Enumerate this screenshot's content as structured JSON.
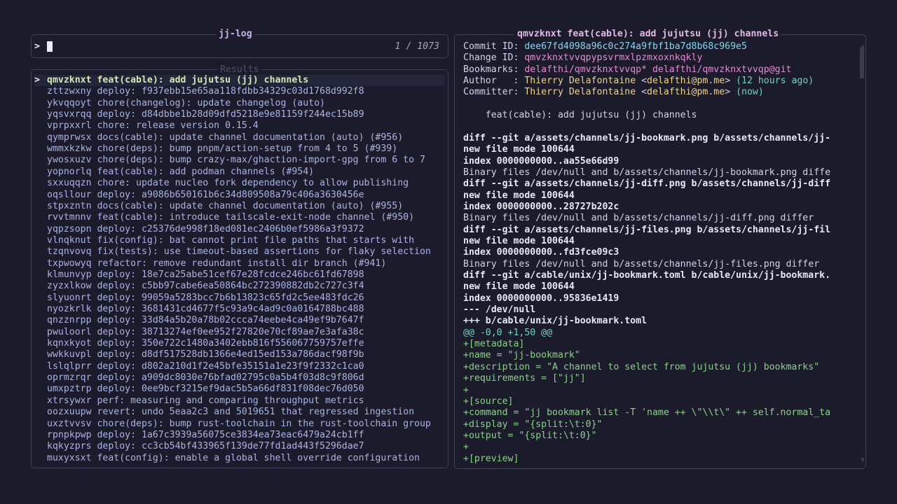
{
  "search": {
    "title": "jj-log",
    "prompt": ">",
    "count": "1 / 1073"
  },
  "results": {
    "title": "Results",
    "selected_marker": ">",
    "items": [
      "qmvzknxt feat(cable): add jujutsu (jj) channels",
      "zttzwxny deploy: f937ebb15e65aa118fdbb34329c03d1768d992f8",
      "ykvqqoyt chore(changelog): update changelog (auto)",
      "yqsvxrqq deploy: d84dbbe1b28d09dfd5218e9e81159f244ec15b89",
      "vprpxxrl chore: release version 0.15.4",
      "qymprwsx docs(cable): update channel documentation (auto) (#956)",
      "wmmxkzkw chore(deps): bump pnpm/action-setup from 4 to 5 (#939)",
      "ywosxuzv chore(deps): bump crazy-max/ghaction-import-gpg from 6 to 7",
      "yopnorlq feat(cable): add podman channels (#954)",
      "sxxuqqzn chore: update nucleo fork dependency to allow publishing",
      "oqsllour deploy: a9086b650161b6c34d809508a79c406a3630456e",
      "stpxzntn docs(cable): update channel documentation (auto) (#955)",
      "rvvtmnnv feat(cable): introduce tailscale-exit-node channel (#950)",
      "yqpzsopn deploy: c25376de998f18ed081ec2406b0ef5986a3f9372",
      "vlnqknut fix(config): bat cannot print file paths that starts with",
      "tzqnvovq fix(tests): use timeout-based assertions for flaky selection",
      "txpwowyq refactor: remove redundant install dir branch (#941)",
      "klmunvyp deploy: 18e7ca25abe51cef67e28fcdce246bc61fd67898",
      "zyzxlkow deploy: c5bb97cabe6ea50864bc272390882db2c727c3f4",
      "slyuonrt deploy: 99059a5283bcc7b6b13823c65fd2c5ee483fdc26",
      "nyozkrlk deploy: 3681431cd4677f5c93a9c4ad9c0a0164788bc488",
      "qnzznrpp deploy: 33d84a5b20a78b02ccca74eebe4ca49ef9b7647f",
      "pwuloorl deploy: 38713274ef0ee952f27820e70cf89ae7e3afa38c",
      "kqnxkyot deploy: 350e722c1480a3402ebb816f556067759757effe",
      "wwkkuvpl deploy: d8df517528db1366e4ed15ed153a786dacf98f9b",
      "lslqlprr deploy: d802a210d1f2e45bfe35151a1e23f9f2332c1ca0",
      "oprmzrqr deploy: a909dc8030e76bfad02795c0a5b4f03d8c9f806d",
      "umxpztrp deploy: 0ee9bcf3215ef9dac5b5a66df831f08dec76d050",
      "xtrsywxr perf: measuring and comparing throughput metrics",
      "oozxuupw revert: undo 5eaa2c3 and 5019651 that regressed ingestion",
      "uxztvvsv chore(deps): bump rust-toolchain in the rust-toolchain group",
      "rpnpkpwp deploy: 1a67c3939a56075ce3834ea73eac6479a24cb1ff",
      "kqkyzprs deploy: cc3cb54bf433965f139de77fd1ad443f5296dae7",
      "muxyxsxt feat(config): enable a global shell override configuration"
    ]
  },
  "preview": {
    "title": "qmvzknxt feat(cable): add jujutsu (jj) channels",
    "lines": [
      [
        {
          "t": "Commit ID: ",
          "c": "k"
        },
        {
          "t": "dee67fd4098a96c0c274a9fbf1ba7d8b68c969e5",
          "c": "cyan"
        }
      ],
      [
        {
          "t": "Change ID: ",
          "c": "k"
        },
        {
          "t": "qmvzknxtvvqpypsvrmxlpzmxoxnkqkly",
          "c": "magenta"
        }
      ],
      [
        {
          "t": "Bookmarks: ",
          "c": "k"
        },
        {
          "t": "delafthi/qmvzknxtvvqp* delafthi/qmvzknxtvvqp@git",
          "c": "magenta"
        }
      ],
      [
        {
          "t": "Author   : ",
          "c": "k"
        },
        {
          "t": "Thierry Delafontaine",
          "c": "yellow"
        },
        {
          "t": " <",
          "c": "k"
        },
        {
          "t": "delafthi@pm.me",
          "c": "yellow"
        },
        {
          "t": "> ",
          "c": "k"
        },
        {
          "t": "(12 hours ago)",
          "c": "teal"
        }
      ],
      [
        {
          "t": "Committer: ",
          "c": "k"
        },
        {
          "t": "Thierry Delafontaine",
          "c": "yellow"
        },
        {
          "t": " <",
          "c": "k"
        },
        {
          "t": "delafthi@pm.me",
          "c": "yellow"
        },
        {
          "t": "> ",
          "c": "k"
        },
        {
          "t": "(now)",
          "c": "teal"
        }
      ],
      [
        {
          "t": "",
          "c": "k"
        }
      ],
      [
        {
          "t": "    feat(cable): add jujutsu (jj) channels",
          "c": "k"
        }
      ],
      [
        {
          "t": "",
          "c": "k"
        }
      ],
      [
        {
          "t": "diff --git a/assets/channels/jj-bookmark.png b/assets/channels/jj-",
          "c": "white-b"
        }
      ],
      [
        {
          "t": "new file mode 100644",
          "c": "white-b"
        }
      ],
      [
        {
          "t": "index 0000000000..aa55e66d99",
          "c": "white-b"
        }
      ],
      [
        {
          "t": "Binary files /dev/null and b/assets/channels/jj-bookmark.png diffe",
          "c": "white"
        }
      ],
      [
        {
          "t": "diff --git a/assets/channels/jj-diff.png b/assets/channels/jj-diff",
          "c": "white-b"
        }
      ],
      [
        {
          "t": "new file mode 100644",
          "c": "white-b"
        }
      ],
      [
        {
          "t": "index 0000000000..28727b202c",
          "c": "white-b"
        }
      ],
      [
        {
          "t": "Binary files /dev/null and b/assets/channels/jj-diff.png differ",
          "c": "white"
        }
      ],
      [
        {
          "t": "diff --git a/assets/channels/jj-files.png b/assets/channels/jj-fil",
          "c": "white-b"
        }
      ],
      [
        {
          "t": "new file mode 100644",
          "c": "white-b"
        }
      ],
      [
        {
          "t": "index 0000000000..fd3fce09c3",
          "c": "white-b"
        }
      ],
      [
        {
          "t": "Binary files /dev/null and b/assets/channels/jj-files.png differ",
          "c": "white"
        }
      ],
      [
        {
          "t": "diff --git a/cable/unix/jj-bookmark.toml b/cable/unix/jj-bookmark.",
          "c": "white-b"
        }
      ],
      [
        {
          "t": "new file mode 100644",
          "c": "white-b"
        }
      ],
      [
        {
          "t": "index 0000000000..95836e1419",
          "c": "white-b"
        }
      ],
      [
        {
          "t": "--- /dev/null",
          "c": "white-b"
        }
      ],
      [
        {
          "t": "+++ b/cable/unix/jj-bookmark.toml",
          "c": "white-b"
        }
      ],
      [
        {
          "t": "@@ -0,0 +1,50 @@",
          "c": "teal"
        }
      ],
      [
        {
          "t": "+[metadata]",
          "c": "green"
        }
      ],
      [
        {
          "t": "+name = \"jj-bookmark\"",
          "c": "green"
        }
      ],
      [
        {
          "t": "+description = \"A channel to select from jujutsu (jj) bookmarks\"",
          "c": "green"
        }
      ],
      [
        {
          "t": "+requirements = [\"jj\"]",
          "c": "green"
        }
      ],
      [
        {
          "t": "+",
          "c": "green"
        }
      ],
      [
        {
          "t": "+[source]",
          "c": "green"
        }
      ],
      [
        {
          "t": "+command = \"jj bookmark list -T 'name ++ \\\"\\\\t\\\" ++ self.normal_ta",
          "c": "green"
        }
      ],
      [
        {
          "t": "+display = \"{split:\\t:0}\"",
          "c": "green"
        }
      ],
      [
        {
          "t": "+output = \"{split:\\t:0}\"",
          "c": "green"
        }
      ],
      [
        {
          "t": "+",
          "c": "green"
        }
      ],
      [
        {
          "t": "+[preview]",
          "c": "green"
        }
      ]
    ],
    "scroll_fraction": 0
  }
}
